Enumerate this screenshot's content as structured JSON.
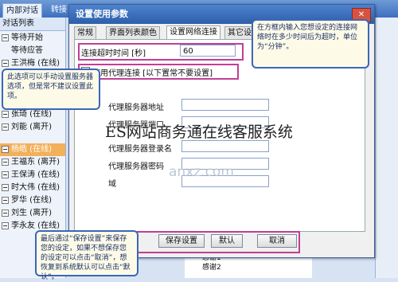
{
  "app": {
    "tabs": [
      "内部对话",
      "转接"
    ],
    "sidebar_title": "对话列表",
    "tree": [
      {
        "label": "等待开始"
      },
      {
        "label": "等待应答"
      },
      {
        "label": "王洪梅 (在线)"
      },
      {
        "label": "张琦 (在线)"
      },
      {
        "label": "刘能 (离开)"
      },
      {
        "label": "杨皓 (在线)",
        "selected": true
      },
      {
        "label": "王福东 (离开)"
      },
      {
        "label": "王保涛 (在线)"
      },
      {
        "label": "时大伟 (在线)"
      },
      {
        "label": "罗华 (在线)"
      },
      {
        "label": "刘生 (离开)"
      },
      {
        "label": "李永友 (在线)"
      }
    ],
    "bottom_items": [
      "感谢1",
      "感谢2"
    ]
  },
  "dialog": {
    "title": "设置使用参数",
    "close_label": "✕",
    "tabs": [
      "常规",
      "界面列表颜色",
      "设置网络连接",
      "其它设置"
    ],
    "active_tab": 2,
    "timeout_label": "连接超时时间 [秒]",
    "timeout_value": "60",
    "proxy_checkbox_label": "使用代理连接 [以下置常不要设置]",
    "proxy_fields": [
      {
        "label": "代理服务器地址",
        "value": ""
      },
      {
        "label": "代理服务器端口",
        "value": ""
      },
      {
        "label": "代理服务器登录名",
        "value": ""
      },
      {
        "label": "代理服务器密码",
        "value": ""
      },
      {
        "label": "域",
        "value": ""
      }
    ],
    "buttons": {
      "save": "保存设置",
      "default": "默认",
      "cancel": "取消"
    }
  },
  "callouts": {
    "right": "在方框内输入您想设定的连接网络时在多少时间后为超时，单位为“分钟”。",
    "left": "此选项可以手动设置服务器选项，但是常不建议设置此项。",
    "bottom": "最后通过“保存设置”来保存您的设定，如果不想保存您的设定可以点击“取消”，想恢复到系统默认可以点击“默认”。"
  },
  "overlay_title": "ES网站商务通在线客服系统",
  "watermark": "anxz.com"
}
